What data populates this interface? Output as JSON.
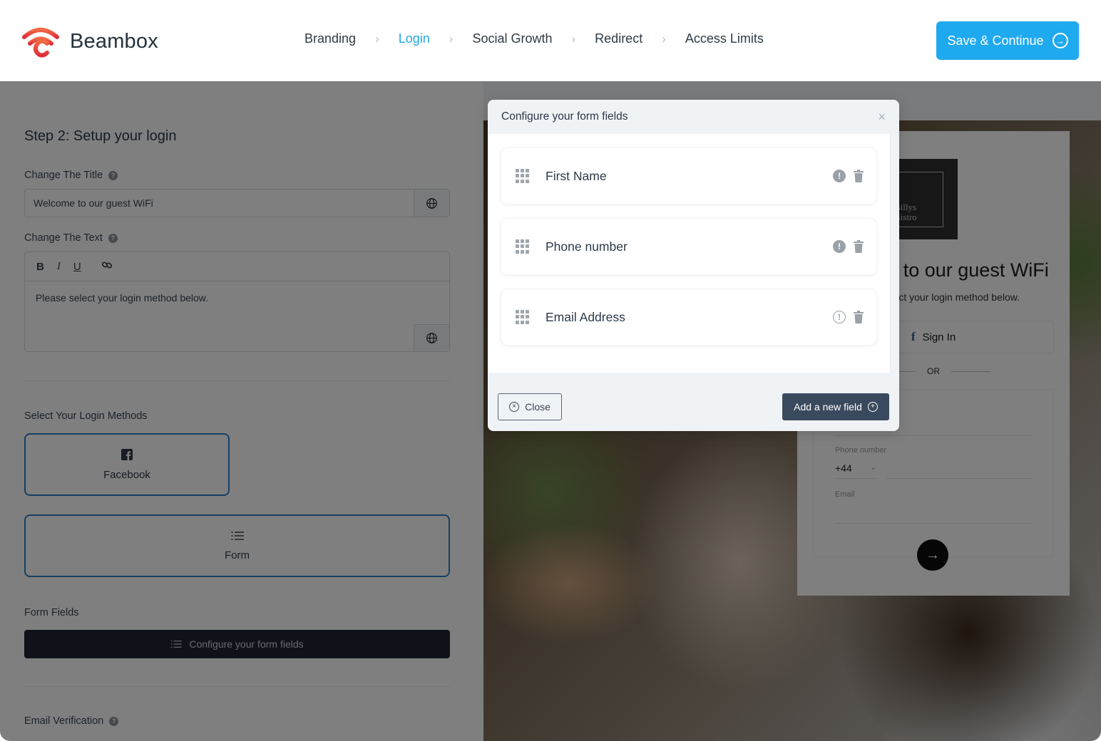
{
  "header": {
    "brand_name": "Beambox",
    "brand_color": "#e8403a",
    "steps": [
      {
        "label": "Branding",
        "active": false
      },
      {
        "label": "Login",
        "active": true
      },
      {
        "label": "Social Growth",
        "active": false
      },
      {
        "label": "Redirect",
        "active": false
      },
      {
        "label": "Access Limits",
        "active": false
      }
    ],
    "step_separator": "›",
    "save_button": {
      "label": "Save & Continue",
      "icon": "arrow-right-circle-icon",
      "color": "#1fa9ef"
    }
  },
  "left_panel": {
    "heading": "Step 2: Setup your login",
    "title_field": {
      "label": "Change The Title",
      "value": "Welcome to our guest WiFi",
      "help_icon": "?"
    },
    "text_field": {
      "label": "Change The Text",
      "help_icon": "?",
      "toolbar": {
        "bold": "B",
        "italic": "I",
        "underline": "U",
        "link_icon": "link-icon"
      },
      "value": "Please select your login method below."
    },
    "login_methods": {
      "label": "Select Your Login Methods",
      "options": [
        {
          "label": "Facebook",
          "icon": "facebook-icon",
          "selected": true
        },
        {
          "label": "Form",
          "icon": "list-icon",
          "selected": true
        }
      ]
    },
    "form_fields": {
      "label": "Form Fields",
      "configure_button": "Configure your form fields"
    },
    "email_verification": {
      "label": "Email Verification",
      "help_icon": "?"
    }
  },
  "preview": {
    "logo_text_line1": "Billys",
    "logo_text_line2": "Bistro",
    "title": "Welcome to our guest WiFi",
    "title_visible": "to our guest WiFi",
    "subtitle": "Please select your login method below.",
    "subtitle_visible": "ct your login method below.",
    "facebook_button": "Sign In",
    "divider_text": "OR",
    "phone_label": "Phone number",
    "phone_code": "+44",
    "email_label": "Email"
  },
  "modal": {
    "title": "Configure your form fields",
    "close_x": "×",
    "fields": [
      {
        "name": "First Name",
        "required": true
      },
      {
        "name": "Phone number",
        "required": true
      },
      {
        "name": "Email Address",
        "required": false
      }
    ],
    "close_button": "Close",
    "add_button": "Add a new field"
  }
}
